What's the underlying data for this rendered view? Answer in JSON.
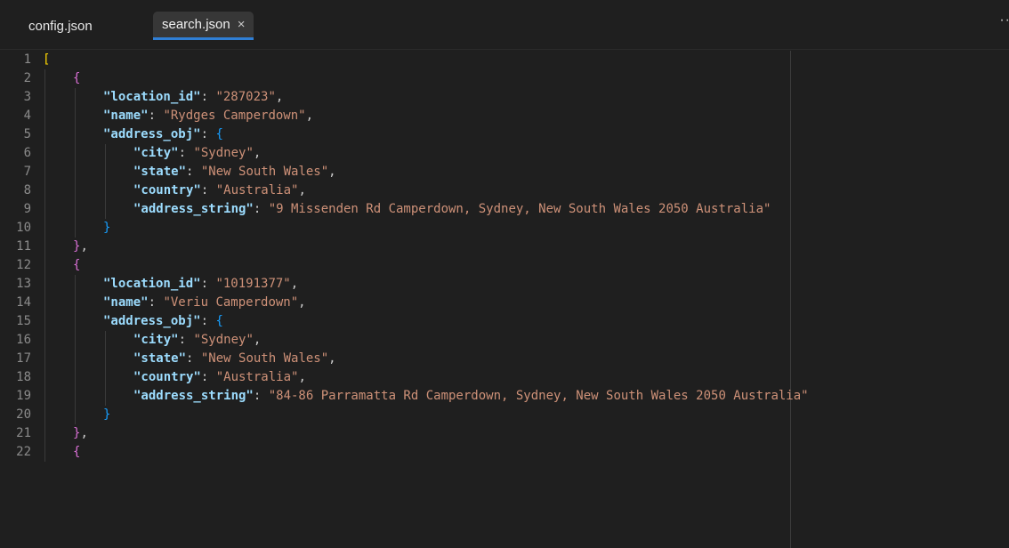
{
  "tabs": [
    {
      "label": "config.json",
      "active": false
    },
    {
      "label": "search.json",
      "active": true,
      "close_glyph": "×"
    }
  ],
  "toolbar": {
    "more_glyph": "··"
  },
  "code_lines": [
    {
      "n": "1",
      "indent": 0,
      "tokens": [
        {
          "t": "[",
          "c": "bracket1"
        }
      ]
    },
    {
      "n": "2",
      "indent": 1,
      "tokens": [
        {
          "t": "{",
          "c": "bracket2"
        }
      ]
    },
    {
      "n": "3",
      "indent": 2,
      "tokens": [
        {
          "t": "\"location_id\"",
          "c": "key"
        },
        {
          "t": ": ",
          "c": "punct"
        },
        {
          "t": "\"287023\"",
          "c": "str"
        },
        {
          "t": ",",
          "c": "punct"
        }
      ]
    },
    {
      "n": "4",
      "indent": 2,
      "tokens": [
        {
          "t": "\"name\"",
          "c": "key"
        },
        {
          "t": ": ",
          "c": "punct"
        },
        {
          "t": "\"Rydges Camperdown\"",
          "c": "str"
        },
        {
          "t": ",",
          "c": "punct"
        }
      ]
    },
    {
      "n": "5",
      "indent": 2,
      "tokens": [
        {
          "t": "\"address_obj\"",
          "c": "key"
        },
        {
          "t": ": ",
          "c": "punct"
        },
        {
          "t": "{",
          "c": "bracket3"
        }
      ]
    },
    {
      "n": "6",
      "indent": 3,
      "tokens": [
        {
          "t": "\"city\"",
          "c": "key"
        },
        {
          "t": ": ",
          "c": "punct"
        },
        {
          "t": "\"Sydney\"",
          "c": "str"
        },
        {
          "t": ",",
          "c": "punct"
        }
      ]
    },
    {
      "n": "7",
      "indent": 3,
      "tokens": [
        {
          "t": "\"state\"",
          "c": "key"
        },
        {
          "t": ": ",
          "c": "punct"
        },
        {
          "t": "\"New South Wales\"",
          "c": "str"
        },
        {
          "t": ",",
          "c": "punct"
        }
      ]
    },
    {
      "n": "8",
      "indent": 3,
      "tokens": [
        {
          "t": "\"country\"",
          "c": "key"
        },
        {
          "t": ": ",
          "c": "punct"
        },
        {
          "t": "\"Australia\"",
          "c": "str"
        },
        {
          "t": ",",
          "c": "punct"
        }
      ]
    },
    {
      "n": "9",
      "indent": 3,
      "tokens": [
        {
          "t": "\"address_string\"",
          "c": "key"
        },
        {
          "t": ": ",
          "c": "punct"
        },
        {
          "t": "\"9 Missenden Rd Camperdown, Sydney, New South Wales 2050 Australia\"",
          "c": "str"
        }
      ]
    },
    {
      "n": "10",
      "indent": 2,
      "tokens": [
        {
          "t": "}",
          "c": "bracket3"
        }
      ]
    },
    {
      "n": "11",
      "indent": 1,
      "tokens": [
        {
          "t": "}",
          "c": "bracket2"
        },
        {
          "t": ",",
          "c": "punct"
        }
      ]
    },
    {
      "n": "12",
      "indent": 1,
      "tokens": [
        {
          "t": "{",
          "c": "bracket2"
        }
      ]
    },
    {
      "n": "13",
      "indent": 2,
      "tokens": [
        {
          "t": "\"location_id\"",
          "c": "key"
        },
        {
          "t": ": ",
          "c": "punct"
        },
        {
          "t": "\"10191377\"",
          "c": "str"
        },
        {
          "t": ",",
          "c": "punct"
        }
      ]
    },
    {
      "n": "14",
      "indent": 2,
      "tokens": [
        {
          "t": "\"name\"",
          "c": "key"
        },
        {
          "t": ": ",
          "c": "punct"
        },
        {
          "t": "\"Veriu Camperdown\"",
          "c": "str"
        },
        {
          "t": ",",
          "c": "punct"
        }
      ]
    },
    {
      "n": "15",
      "indent": 2,
      "tokens": [
        {
          "t": "\"address_obj\"",
          "c": "key"
        },
        {
          "t": ": ",
          "c": "punct"
        },
        {
          "t": "{",
          "c": "bracket3"
        }
      ]
    },
    {
      "n": "16",
      "indent": 3,
      "tokens": [
        {
          "t": "\"city\"",
          "c": "key"
        },
        {
          "t": ": ",
          "c": "punct"
        },
        {
          "t": "\"Sydney\"",
          "c": "str"
        },
        {
          "t": ",",
          "c": "punct"
        }
      ]
    },
    {
      "n": "17",
      "indent": 3,
      "tokens": [
        {
          "t": "\"state\"",
          "c": "key"
        },
        {
          "t": ": ",
          "c": "punct"
        },
        {
          "t": "\"New South Wales\"",
          "c": "str"
        },
        {
          "t": ",",
          "c": "punct"
        }
      ]
    },
    {
      "n": "18",
      "indent": 3,
      "tokens": [
        {
          "t": "\"country\"",
          "c": "key"
        },
        {
          "t": ": ",
          "c": "punct"
        },
        {
          "t": "\"Australia\"",
          "c": "str"
        },
        {
          "t": ",",
          "c": "punct"
        }
      ]
    },
    {
      "n": "19",
      "indent": 3,
      "tokens": [
        {
          "t": "\"address_string\"",
          "c": "key"
        },
        {
          "t": ": ",
          "c": "punct"
        },
        {
          "t": "\"84-86 Parramatta Rd Camperdown, Sydney, New South Wales 2050 Australia\"",
          "c": "str"
        }
      ]
    },
    {
      "n": "20",
      "indent": 2,
      "tokens": [
        {
          "t": "}",
          "c": "bracket3"
        }
      ]
    },
    {
      "n": "21",
      "indent": 1,
      "tokens": [
        {
          "t": "}",
          "c": "bracket2"
        },
        {
          "t": ",",
          "c": "punct"
        }
      ]
    },
    {
      "n": "22",
      "indent": 1,
      "tokens": [
        {
          "t": "{",
          "c": "bracket2"
        }
      ]
    }
  ]
}
